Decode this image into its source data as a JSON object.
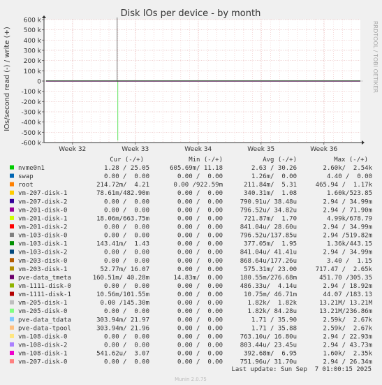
{
  "chart_data": {
    "type": "line",
    "title": "Disk IOs per device - by month",
    "ylabel": "IOs/second read (-) / write (+)",
    "ylim": [
      -600000,
      600000
    ],
    "yticks": [
      {
        "v": 600000,
        "label": "600 k"
      },
      {
        "v": 500000,
        "label": "500 k"
      },
      {
        "v": 400000,
        "label": "400 k"
      },
      {
        "v": 300000,
        "label": "300 k"
      },
      {
        "v": 200000,
        "label": "200 k"
      },
      {
        "v": 100000,
        "label": "100 k"
      },
      {
        "v": 0,
        "label": "0"
      },
      {
        "v": -100000,
        "label": "-100 k"
      },
      {
        "v": -200000,
        "label": "-200 k"
      },
      {
        "v": -300000,
        "label": "-300 k"
      },
      {
        "v": -400000,
        "label": "-400 k"
      },
      {
        "v": -500000,
        "label": "-500 k"
      },
      {
        "v": -600000,
        "label": "-600 k"
      }
    ],
    "xlim": [
      0,
      5
    ],
    "xticks": [
      {
        "v": 0.42,
        "label": "Week 32"
      },
      {
        "v": 1.42,
        "label": "Week 33"
      },
      {
        "v": 2.42,
        "label": "Week 34"
      },
      {
        "v": 3.42,
        "label": "Week 35"
      },
      {
        "v": 4.42,
        "label": "Week 36"
      }
    ],
    "grid": true,
    "spikes": [
      {
        "x": 1.13,
        "y": 620000,
        "color": "#8c8c8c"
      },
      {
        "x": 1.14,
        "y": -580000,
        "color": "#7ae87a"
      }
    ],
    "baseline_color": "#5a1a5a"
  },
  "side_label": "RRDTOOL / TOBI OETIKER",
  "headers": {
    "cur": "Cur (-/+)",
    "min": "Min (-/+)",
    "avg": "Avg (-/+)",
    "max": "Max (-/+)"
  },
  "legend": [
    {
      "name": "nvme0n1",
      "color": "#00cc00",
      "cur": "1.28 / 25.05",
      "min": "605.69m/ 11.18",
      "avg": "2.63 / 30.26",
      "max": "2.60k/  2.54k"
    },
    {
      "name": "swap",
      "color": "#0066b3",
      "cur": "0.00 /  0.00",
      "min": "0.00 /  0.00",
      "avg": "1.26m/  0.00",
      "max": "4.40 /  0.00"
    },
    {
      "name": "root",
      "color": "#ff8000",
      "cur": "214.72m/  4.21",
      "min": "0.00 /922.59m",
      "avg": "211.84m/  5.31",
      "max": "465.94 /  1.17k"
    },
    {
      "name": "vm-207-disk-1",
      "color": "#ffcc00",
      "cur": "78.61m/482.90m",
      "min": "0.00 /  0.00",
      "avg": "340.31m/  1.08",
      "max": "1.60k/523.85"
    },
    {
      "name": "vm-207-disk-2",
      "color": "#330099",
      "cur": "0.00 /  0.00",
      "min": "0.00 /  0.00",
      "avg": "790.91u/ 38.48u",
      "max": "2.94 / 34.99m"
    },
    {
      "name": "vm-201-disk-0",
      "color": "#990099",
      "cur": "0.00 /  0.00",
      "min": "0.00 /  0.00",
      "avg": "796.52u/ 34.82u",
      "max": "2.94 / 71.90m"
    },
    {
      "name": "vm-201-disk-1",
      "color": "#ccff00",
      "cur": "18.06m/663.75m",
      "min": "0.00 /  0.00",
      "avg": "721.87m/  1.70",
      "max": "4.99k/678.79"
    },
    {
      "name": "vm-201-disk-2",
      "color": "#ff0000",
      "cur": "0.00 /  0.00",
      "min": "0.00 /  0.00",
      "avg": "841.04u/ 28.60u",
      "max": "2.94 / 34.99m"
    },
    {
      "name": "vm-103-disk-0",
      "color": "#808080",
      "cur": "0.00 /  0.00",
      "min": "0.00 /  0.00",
      "avg": "796.52u/137.85u",
      "max": "2.94 /519.82m"
    },
    {
      "name": "vm-103-disk-1",
      "color": "#008f00",
      "cur": "143.41m/  1.43",
      "min": "0.00 /  0.00",
      "avg": "377.05m/  1.95",
      "max": "1.36k/443.15"
    },
    {
      "name": "vm-103-disk-2",
      "color": "#00487d",
      "cur": "0.00 /  0.00",
      "min": "0.00 /  0.00",
      "avg": "841.04u/ 41.41u",
      "max": "2.94 / 34.99m"
    },
    {
      "name": "vm-203-disk-0",
      "color": "#b35a00",
      "cur": "0.00 /  0.00",
      "min": "0.00 /  0.00",
      "avg": "868.64u/177.26u",
      "max": "3.40 /  1.15"
    },
    {
      "name": "vm-203-disk-1",
      "color": "#b38f00",
      "cur": "52.77m/ 16.07",
      "min": "0.00 /  0.00",
      "avg": "575.31m/ 23.00",
      "max": "717.47 /  2.65k"
    },
    {
      "name": "pve-data_tmeta",
      "color": "#6b006b",
      "cur": "160.51m/ 40.28m",
      "min": "14.83m/  0.00",
      "avg": "180.55m/276.68m",
      "max": "451.70 /305.35"
    },
    {
      "name": "vm-1111-disk-0",
      "color": "#8fb300",
      "cur": "0.00 /  0.00",
      "min": "0.00 /  0.00",
      "avg": "486.33u/  4.14u",
      "max": "2.94 / 18.92m"
    },
    {
      "name": "vm-1111-disk-1",
      "color": "#b30000",
      "cur": "10.56m/101.55m",
      "min": "0.00 /  0.00",
      "avg": "10.75m/ 46.71m",
      "max": "44.07 /183.13"
    },
    {
      "name": "vm-205-disk-1",
      "color": "#bebebe",
      "cur": "0.00 /145.30m",
      "min": "0.00 /  0.00",
      "avg": "1.82k/  1.82k",
      "max": "13.21M/ 13.21M"
    },
    {
      "name": "vm-205-disk-0",
      "color": "#80ff80",
      "cur": "0.00 /  0.00",
      "min": "0.00 /  0.00",
      "avg": "1.82k/ 84.28u",
      "max": "13.21M/236.86m"
    },
    {
      "name": "pve-data_tdata",
      "color": "#80c9ff",
      "cur": "303.94m/ 21.97",
      "min": "0.00 /  0.00",
      "avg": "1.71 / 35.90",
      "max": "2.59k/  2.67k"
    },
    {
      "name": "pve-data-tpool",
      "color": "#ffc080",
      "cur": "303.94m/ 21.96",
      "min": "0.00 /  0.00",
      "avg": "1.71 / 35.88",
      "max": "2.59k/  2.67k"
    },
    {
      "name": "vm-108-disk-0",
      "color": "#ffe680",
      "cur": "0.00 /  0.00",
      "min": "0.00 /  0.00",
      "avg": "763.10u/ 16.80u",
      "max": "2.94 / 22.93m"
    },
    {
      "name": "vm-108-disk-2",
      "color": "#aa80ff",
      "cur": "0.00 /  0.00",
      "min": "0.00 /  0.00",
      "avg": "803.44u/ 23.45u",
      "max": "2.94 / 43.73m"
    },
    {
      "name": "vm-108-disk-1",
      "color": "#ee00cc",
      "cur": "541.62u/  3.07",
      "min": "0.00 /  0.00",
      "avg": "392.68m/  6.95",
      "max": "1.60k/  2.35k"
    },
    {
      "name": "vm-207-disk-0",
      "color": "#ff8080",
      "cur": "0.00 /  0.00",
      "min": "0.00 /  0.00",
      "avg": "751.96u/ 31.70u",
      "max": "2.94 / 26.34m"
    }
  ],
  "last_update": "Last update: Sun Sep  7 01:00:15 2025",
  "footer": "Munin 2.0.75"
}
